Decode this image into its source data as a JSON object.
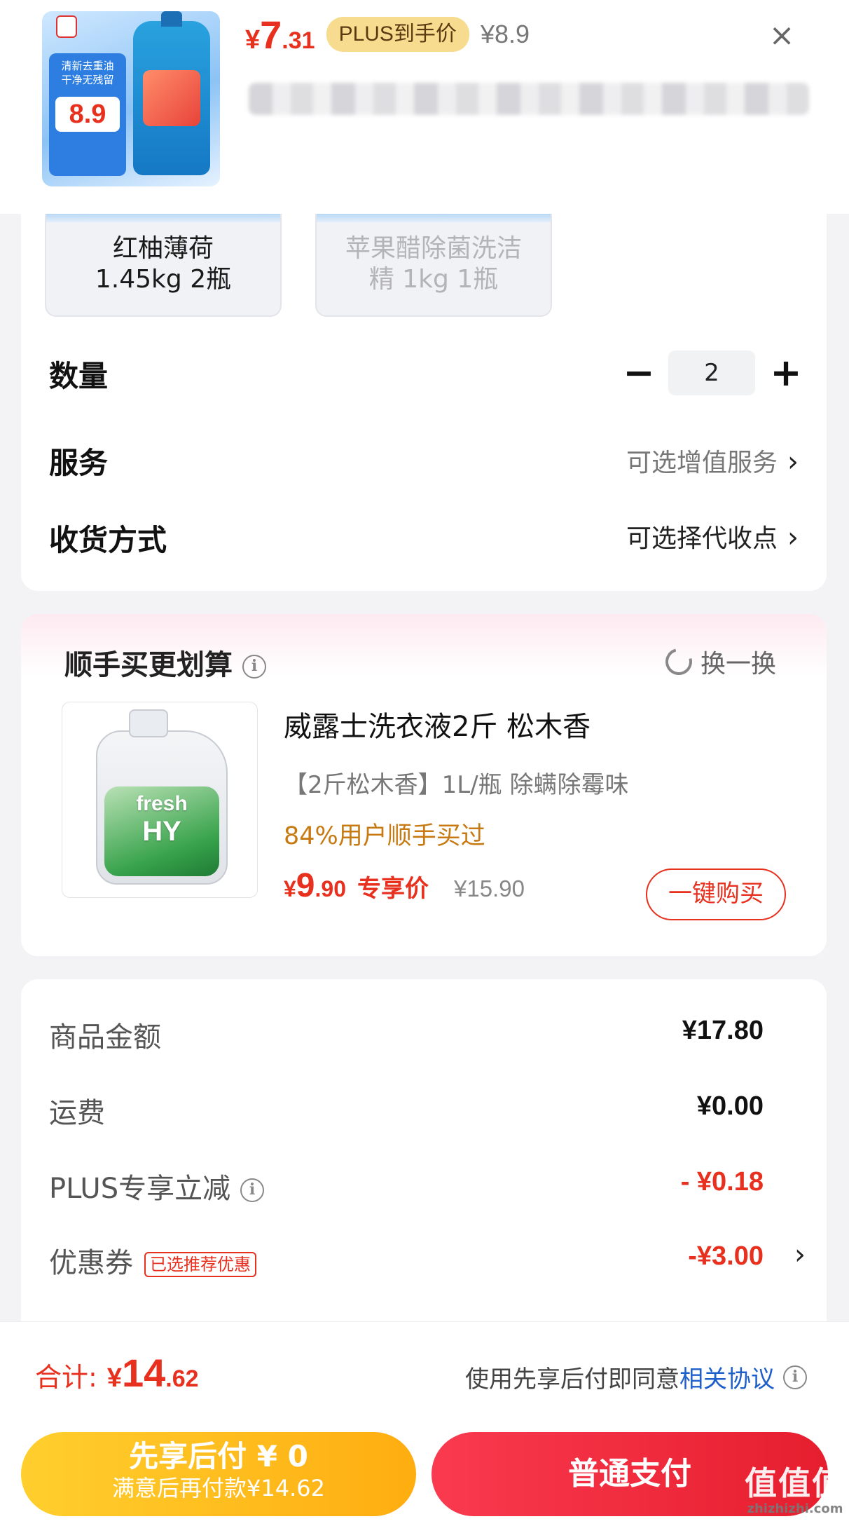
{
  "header": {
    "price_symbol": "¥",
    "price_int": "7",
    "price_dec": ".31",
    "plus_tag": "PLUS到手价",
    "original_price": "¥8.9",
    "close_icon": "×",
    "thumb": {
      "badge_line1": "清新去重油",
      "badge_line2": "干净无残留",
      "badge_price": "8.9"
    }
  },
  "spec": {
    "options": [
      {
        "label_line1": "红柚薄荷",
        "label_line2": "1.45kg 2瓶",
        "state": "enabled"
      },
      {
        "label_line1": "苹果醋除菌洗洁",
        "label_line2": "精 1kg 1瓶",
        "state": "disabled"
      }
    ],
    "quantity_label": "数量",
    "quantity_value": "2",
    "minus_icon": "−",
    "plus_icon": "+",
    "service_label": "服务",
    "service_value": "可选增值服务",
    "delivery_label": "收货方式",
    "delivery_value": "可选择代收点",
    "chevron": "›"
  },
  "recommend": {
    "title": "顺手买更划算",
    "info_icon": "i",
    "refresh_label": "换一换",
    "product": {
      "name": "威露士洗衣液2斤 松木香",
      "desc": "【2斤松木香】1L/瓶 除螨除霉味",
      "stat": "84%用户顺手买过",
      "price_symbol": "¥",
      "price_int": "9",
      "price_dec": ".90",
      "price_tag": "专享价",
      "original_price": "¥15.90",
      "buy_label": "一键购买",
      "brand_line1": "fresh",
      "brand_line2": "HY"
    }
  },
  "fees": {
    "goods_label": "商品金额",
    "goods_value": "¥17.80",
    "shipping_label": "运费",
    "shipping_value": "¥0.00",
    "plus_label": "PLUS专享立减",
    "plus_value": "- ¥0.18",
    "coupon_label": "优惠券",
    "coupon_tag": "已选推荐优惠",
    "coupon_value": "-¥3.00",
    "chevron": "›"
  },
  "bottom": {
    "total_label": "合计:",
    "total_symbol": "¥",
    "total_int": "14",
    "total_dec": ".62",
    "agree_text": "使用先享后付即同意",
    "agree_link": "相关协议",
    "bnpl_line1": "先享后付 ¥ 0",
    "bnpl_line2": "满意后再付款¥14.62",
    "pay_label": "普通支付",
    "watermark_line1": "值值值",
    "watermark_line2": "zhizhizhi.com"
  },
  "colors": {
    "accent_red": "#e8301f",
    "bnpl_yellow": "#ffb716",
    "link_blue": "#1f5fc9",
    "stat_orange": "#c87a12"
  }
}
